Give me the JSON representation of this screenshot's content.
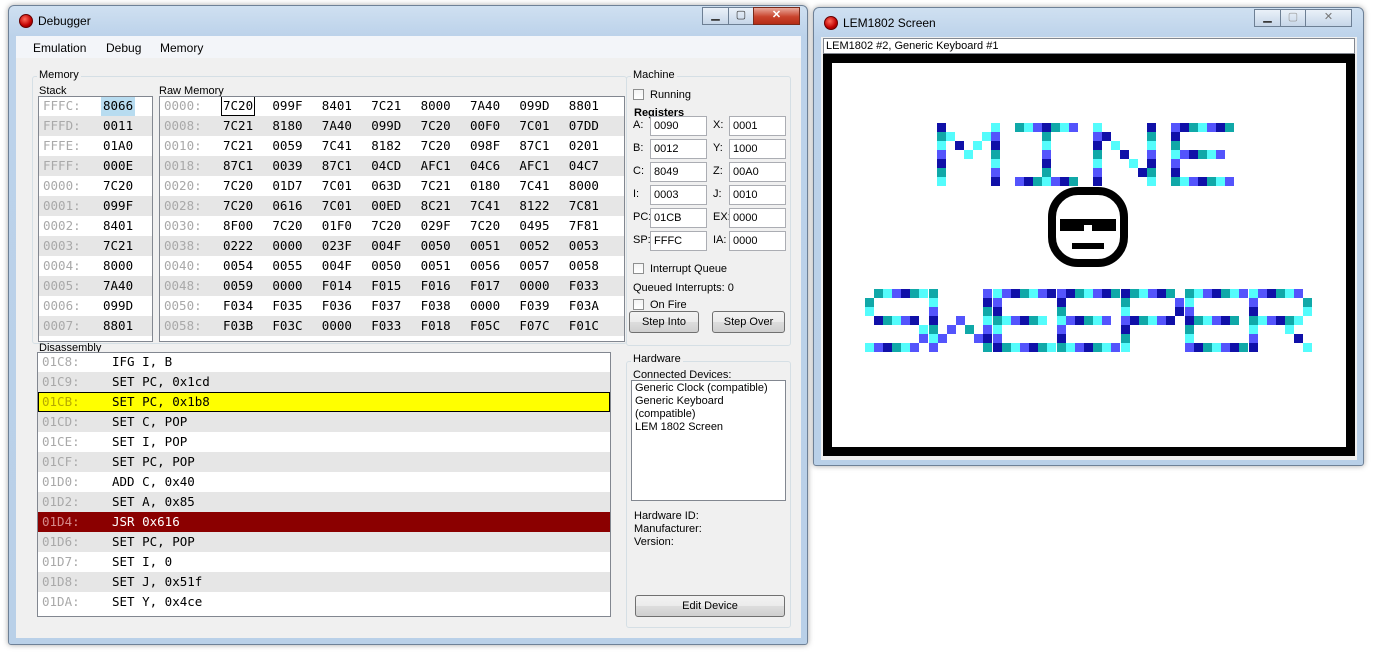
{
  "debugger_window": {
    "title": "Debugger",
    "menu": [
      "Emulation",
      "Debug",
      "Memory"
    ],
    "memory_group_label": "Memory",
    "stack_label": "Stack",
    "raw_memory_label": "Raw Memory",
    "stack": [
      {
        "addr": "FFFC:",
        "value": "8066"
      },
      {
        "addr": "FFFD:",
        "value": "0011"
      },
      {
        "addr": "FFFE:",
        "value": "01A0"
      },
      {
        "addr": "FFFF:",
        "value": "000E"
      },
      {
        "addr": "0000:",
        "value": "7C20"
      },
      {
        "addr": "0001:",
        "value": "099F"
      },
      {
        "addr": "0002:",
        "value": "8401"
      },
      {
        "addr": "0003:",
        "value": "7C21"
      },
      {
        "addr": "0004:",
        "value": "8000"
      },
      {
        "addr": "0005:",
        "value": "7A40"
      },
      {
        "addr": "0006:",
        "value": "099D"
      },
      {
        "addr": "0007:",
        "value": "8801"
      }
    ],
    "raw_memory": [
      {
        "addr": "0000:",
        "words": [
          "7C20",
          "099F",
          "8401",
          "7C21",
          "8000",
          "7A40",
          "099D",
          "8801"
        ]
      },
      {
        "addr": "0008:",
        "words": [
          "7C21",
          "8180",
          "7A40",
          "099D",
          "7C20",
          "00F0",
          "7C01",
          "07DD"
        ]
      },
      {
        "addr": "0010:",
        "words": [
          "7C21",
          "0059",
          "7C41",
          "8182",
          "7C20",
          "098F",
          "87C1",
          "0201"
        ]
      },
      {
        "addr": "0018:",
        "words": [
          "87C1",
          "0039",
          "87C1",
          "04CD",
          "AFC1",
          "04C6",
          "AFC1",
          "04C7"
        ]
      },
      {
        "addr": "0020:",
        "words": [
          "7C20",
          "01D7",
          "7C01",
          "063D",
          "7C21",
          "0180",
          "7C41",
          "8000"
        ]
      },
      {
        "addr": "0028:",
        "words": [
          "7C20",
          "0616",
          "7C01",
          "00ED",
          "8C21",
          "7C41",
          "8122",
          "7C81"
        ]
      },
      {
        "addr": "0030:",
        "words": [
          "8F00",
          "7C20",
          "01F0",
          "7C20",
          "029F",
          "7C20",
          "0495",
          "7F81"
        ]
      },
      {
        "addr": "0038:",
        "words": [
          "0222",
          "0000",
          "023F",
          "004F",
          "0050",
          "0051",
          "0052",
          "0053"
        ]
      },
      {
        "addr": "0040:",
        "words": [
          "0054",
          "0055",
          "004F",
          "0050",
          "0051",
          "0056",
          "0057",
          "0058"
        ]
      },
      {
        "addr": "0048:",
        "words": [
          "0059",
          "0000",
          "F014",
          "F015",
          "F016",
          "F017",
          "0000",
          "F033"
        ]
      },
      {
        "addr": "0050:",
        "words": [
          "F034",
          "F035",
          "F036",
          "F037",
          "F038",
          "0000",
          "F039",
          "F03A"
        ]
      },
      {
        "addr": "0058:",
        "words": [
          "F03B",
          "F03C",
          "0000",
          "F033",
          "F018",
          "F05C",
          "F07C",
          "F01C"
        ]
      }
    ],
    "disassembly_label": "Disassembly",
    "disassembly": [
      {
        "addr": "01C8:",
        "instr": "IFG I, B",
        "state": "normal"
      },
      {
        "addr": "01C9:",
        "instr": "SET PC, 0x1cd",
        "state": "normal"
      },
      {
        "addr": "01CB:",
        "instr": "SET PC, 0x1b8",
        "state": "current"
      },
      {
        "addr": "01CD:",
        "instr": "SET C, POP",
        "state": "normal"
      },
      {
        "addr": "01CE:",
        "instr": "SET I, POP",
        "state": "normal"
      },
      {
        "addr": "01CF:",
        "instr": "SET PC, POP",
        "state": "normal"
      },
      {
        "addr": "01D0:",
        "instr": "ADD C, 0x40",
        "state": "normal"
      },
      {
        "addr": "01D2:",
        "instr": "SET A, 0x85",
        "state": "normal"
      },
      {
        "addr": "01D4:",
        "instr": "JSR 0x616",
        "state": "breakpoint"
      },
      {
        "addr": "01D6:",
        "instr": "SET PC, POP",
        "state": "normal"
      },
      {
        "addr": "01D7:",
        "instr": "SET I, 0",
        "state": "normal"
      },
      {
        "addr": "01D8:",
        "instr": "SET J, 0x51f",
        "state": "normal"
      },
      {
        "addr": "01DA:",
        "instr": "SET Y, 0x4ce",
        "state": "normal"
      }
    ],
    "machine": {
      "group_label": "Machine",
      "running_label": "Running",
      "running_checked": false,
      "registers_label": "Registers",
      "registers": [
        {
          "name": "A:",
          "value": "0090"
        },
        {
          "name": "X:",
          "value": "0001"
        },
        {
          "name": "B:",
          "value": "0012"
        },
        {
          "name": "Y:",
          "value": "1000"
        },
        {
          "name": "C:",
          "value": "8049"
        },
        {
          "name": "Z:",
          "value": "00A0"
        },
        {
          "name": "I:",
          "value": "0003"
        },
        {
          "name": "J:",
          "value": "0010"
        },
        {
          "name": "PC:",
          "value": "01CB"
        },
        {
          "name": "EX:",
          "value": "0000"
        },
        {
          "name": "SP:",
          "value": "FFFC"
        },
        {
          "name": "IA:",
          "value": "0000"
        }
      ],
      "interrupt_queue_label": "Interrupt Queue",
      "queued_interrupts_label": "Queued Interrupts: 0",
      "on_fire_label": "On Fire",
      "step_into_label": "Step Into",
      "step_over_label": "Step Over"
    },
    "hardware": {
      "group_label": "Hardware",
      "connected_label": "Connected Devices:",
      "devices": [
        "Generic Clock (compatible)",
        "Generic Keyboard (compatible)",
        "LEM 1802 Screen"
      ],
      "hardware_id_label": "Hardware ID:",
      "manufacturer_label": "Manufacturer:",
      "version_label": "Version:",
      "edit_device_label": "Edit Device"
    }
  },
  "lem_window": {
    "title": "LEM1802 Screen",
    "device_label": "LEM1802 #2, Generic Keyboard #1",
    "screen_text": [
      "MINE",
      "SWEEPER"
    ],
    "colors": {
      "border": "#000000",
      "background": "#ffffff",
      "dark_blue": "#1010a8",
      "cyan": "#10a8a8",
      "light_cyan": "#54fcfc",
      "blue": "#5454fc"
    }
  },
  "theme": {
    "highlight_current": "#ffff00",
    "highlight_breakpoint": "#8b0000",
    "stack_select": "#b8dcf0",
    "row_alt": "#e6e6e6"
  }
}
